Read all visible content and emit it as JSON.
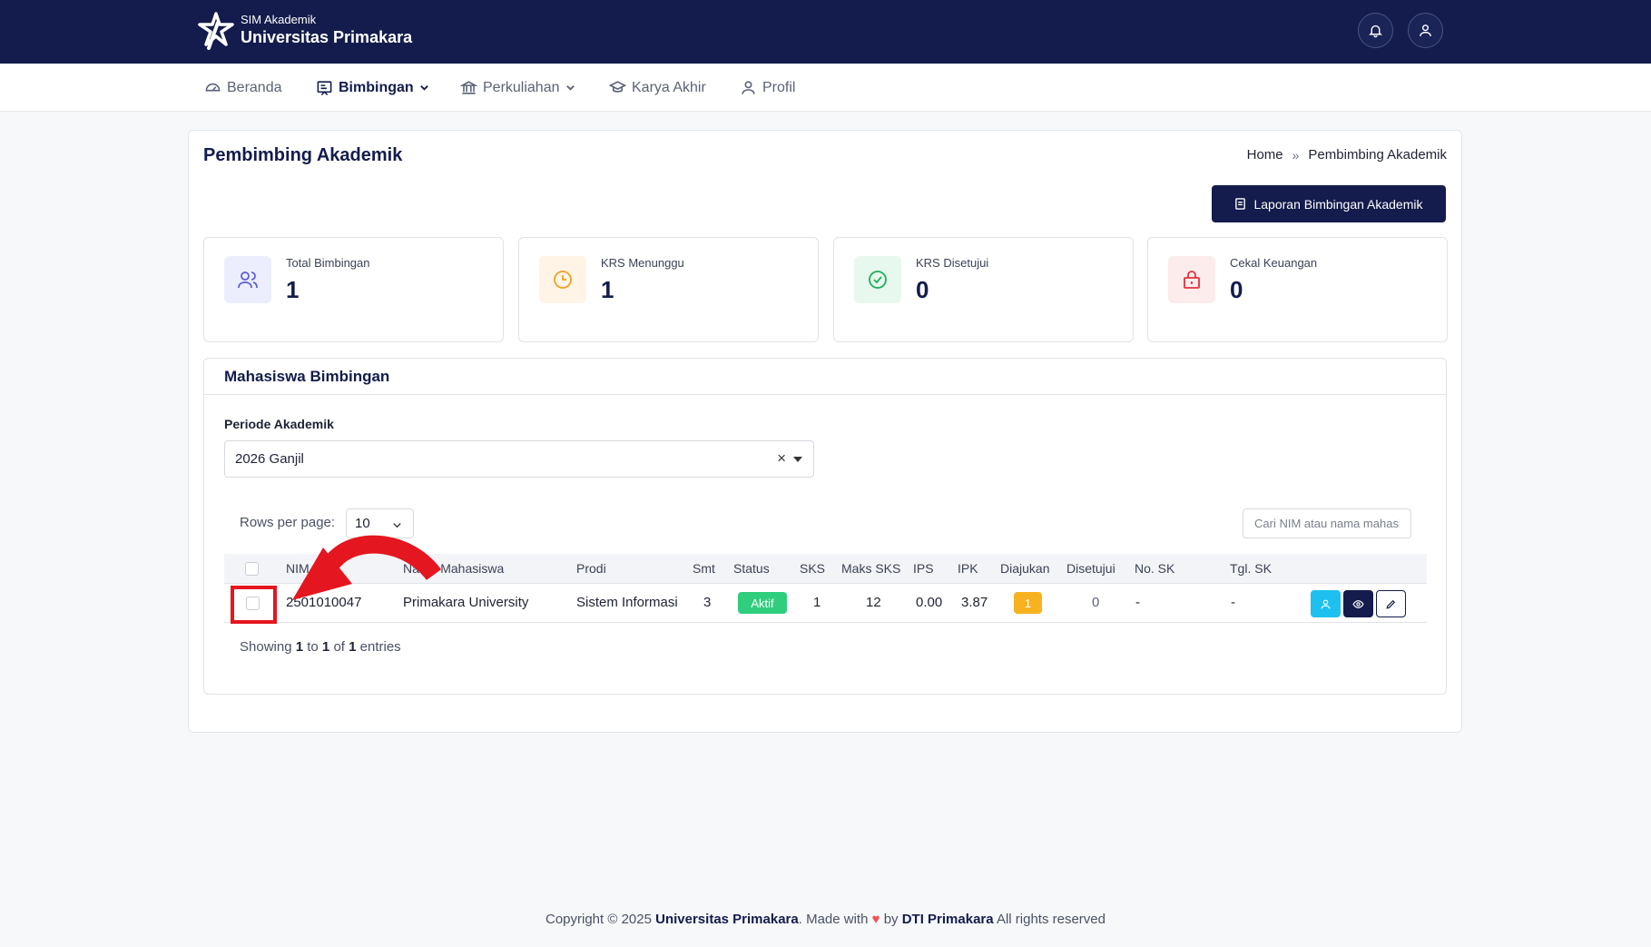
{
  "app": {
    "subtitle": "SIM Akademik",
    "title": "Universitas Primakara"
  },
  "nav": {
    "items": [
      {
        "label": "Beranda",
        "icon": "dashboard-icon"
      },
      {
        "label": "Bimbingan",
        "icon": "board-icon",
        "active": true,
        "dropdown": true
      },
      {
        "label": "Perkuliahan",
        "icon": "bank-icon",
        "dropdown": true
      },
      {
        "label": "Karya Akhir",
        "icon": "graduation-cap-icon"
      },
      {
        "label": "Profil",
        "icon": "user-icon"
      }
    ]
  },
  "page": {
    "title": "Pembimbing Akademik",
    "breadcrumb": {
      "home": "Home",
      "sep": "»",
      "current": "Pembimbing Akademik"
    },
    "report_button": "Laporan Bimbingan Akademik"
  },
  "stats": [
    {
      "label": "Total Bimbingan",
      "value": "1",
      "icon": "users-icon",
      "color": "#5b5fd6",
      "bg": "#eceefe"
    },
    {
      "label": "KRS Menunggu",
      "value": "1",
      "icon": "clock-icon",
      "color": "#f0a020",
      "bg": "#fff4e6"
    },
    {
      "label": "KRS Disetujui",
      "value": "0",
      "icon": "check-circle-icon",
      "color": "#1fae5a",
      "bg": "#e7f8ee"
    },
    {
      "label": "Cekal Keuangan",
      "value": "0",
      "icon": "lock-icon",
      "color": "#e0323c",
      "bg": "#fdecec"
    }
  ],
  "table_section": {
    "title": "Mahasiswa Bimbingan",
    "period_label": "Periode Akademik",
    "period_value": "2026 Ganjil",
    "period_clear": "×",
    "rows_per_page_label": "Rows per page:",
    "rows_per_page_value": "10",
    "search_placeholder": "Cari NIM atau nama mahasiswa",
    "columns": [
      "NIM",
      "Nama Mahasiswa",
      "Prodi",
      "Smt",
      "Status",
      "SKS",
      "Maks SKS",
      "IPS",
      "IPK",
      "Diajukan",
      "Disetujui",
      "No. SK",
      "Tgl. SK"
    ],
    "rows": [
      {
        "nim": "2501010047",
        "nama": "Primakara University",
        "prodi": "Sistem Informasi",
        "smt": "3",
        "status": "Aktif",
        "sks": "1",
        "maks_sks": "12",
        "ips": "0.00",
        "ipk": "3.87",
        "diajukan": "1",
        "disetujui": "0",
        "no_sk": "-",
        "tgl_sk": "-"
      }
    ],
    "showing": {
      "prefix": "Showing",
      "from": "1",
      "to_word": "to",
      "to": "1",
      "of_word": "of",
      "total": "1",
      "suffix": "entries"
    }
  },
  "footer": {
    "prefix": "Copyright © 2025",
    "org": "Universitas Primakara",
    "made": ". Made with",
    "by": "by",
    "team": "DTI Primakara",
    "suffix": "All rights reserved"
  },
  "colors": {
    "navy": "#131c4c",
    "aktif": "#2fce7d",
    "diajukan": "#f7b21f",
    "action_cyan": "#1ec0f0",
    "annotation_red": "#e4161f"
  }
}
